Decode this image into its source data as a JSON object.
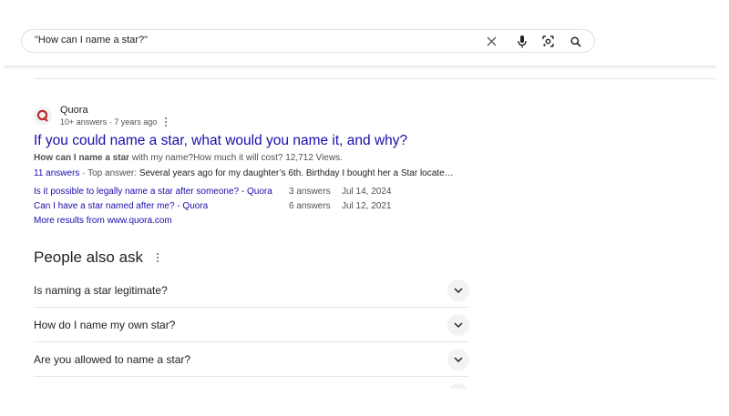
{
  "search": {
    "query": "\"How can I name a star?\"",
    "icons": [
      "close-icon",
      "microphone-icon",
      "lens-icon",
      "search-icon"
    ]
  },
  "result": {
    "site_name": "Quora",
    "meta": "10+ answers · 7 years ago",
    "title": "If you could name a star, what would you name it, and why?",
    "snippet_bold": "How can I name a star",
    "snippet_rest": " with my name?How much it will cost? 12,712 Views.",
    "answers_link": "11 answers",
    "top_answer_label": " · Top answer: ",
    "top_answer_text": "Several years ago for my daughter’s 6th. Birthday I bought her a Star locate…",
    "sub_results": [
      {
        "title": "Is it possible to legally name a star after someone? - Quora",
        "count": "3 answers",
        "date": "Jul 14, 2024"
      },
      {
        "title": "Can I have a star named after me? - Quora",
        "count": "6 answers",
        "date": "Jul 12, 2021"
      }
    ],
    "more_results": "More results from www.quora.com"
  },
  "paa": {
    "title": "People also ask",
    "questions": [
      "Is naming a star legitimate?",
      "How do I name my own star?",
      "Are you allowed to name a star?"
    ]
  },
  "colors": {
    "link": "#1a0dab",
    "text": "#202124",
    "secondary": "#4d5156",
    "quora_red": "#b92b27"
  }
}
